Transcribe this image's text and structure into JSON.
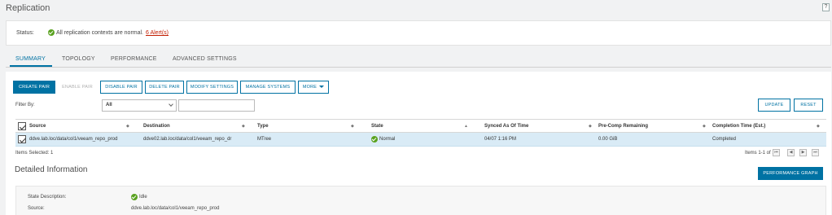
{
  "page": {
    "title": "Replication",
    "help_label": "?"
  },
  "status": {
    "label": "Status:",
    "text": "All replication contexts are normal.",
    "alerts_link": "6 Alert(s)"
  },
  "tabs": [
    {
      "label": "SUMMARY",
      "active": true
    },
    {
      "label": "TOPOLOGY",
      "active": false
    },
    {
      "label": "PERFORMANCE",
      "active": false
    },
    {
      "label": "ADVANCED SETTINGS",
      "active": false
    }
  ],
  "toolbar": {
    "create_pair": "CREATE PAIR",
    "enable_pair": "ENABLE PAIR",
    "disable_pair": "DISABLE PAIR",
    "delete_pair": "DELETE PAIR",
    "modify_settings": "MODIFY SETTINGS",
    "manage_systems": "MANAGE SYSTEMS",
    "more": "MORE"
  },
  "filter": {
    "label": "Filter By:",
    "selected": "All",
    "text_value": "",
    "update": "UPDATE",
    "reset": "RESET"
  },
  "grid": {
    "headers": [
      "Source",
      "Destination",
      "Type",
      "State",
      "Synced As Of Time",
      "Pre-Comp Remaining",
      "Completion Time (Est.)"
    ],
    "sort_glyph": "◆",
    "sort_asc_glyph": "▲",
    "rows": [
      {
        "source": "ddve.lab.loc/data/col1/veeam_repo_prod",
        "destination": "ddve02.lab.loc/data/col1/veeam_repo_dr",
        "type": "MTree",
        "state": "Normal",
        "synced": "04/07 1:16 PM",
        "precomp": "0.00 GiB",
        "completion": "Completed"
      }
    ]
  },
  "footer": {
    "items_selected": "Items Selected: 1",
    "items_range": "Items 1-1 of 1",
    "pager": [
      "⏮",
      "◀",
      "▶",
      "⏭"
    ]
  },
  "detail": {
    "title": "Detailed Information",
    "perf_button": "PERFORMANCE GRAPH",
    "state_label": "State Description:",
    "state_value": "Idle",
    "source_label": "Source:",
    "source_value": "ddve.lab.loc/data/col1/veeam_repo_prod"
  },
  "colors": {
    "accent": "#0072a3",
    "ok": "#5aa220",
    "alert": "#c21d00",
    "row_selected": "#d9ebf6"
  }
}
